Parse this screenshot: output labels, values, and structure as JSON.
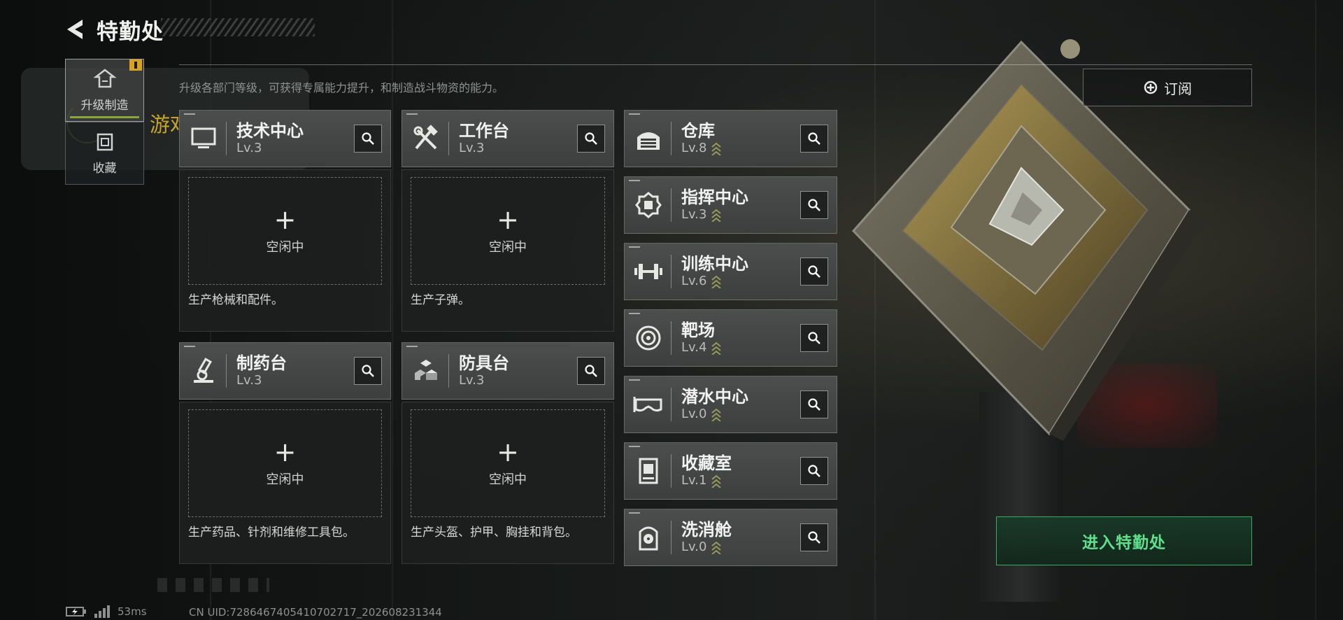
{
  "header": {
    "title": "特勤处"
  },
  "subtitle": "升级各部门等级，可获得专属能力提升，和制造战斗物资的能力。",
  "sidenav": {
    "items": [
      {
        "label": "升级制造",
        "icon": "upgrade-icon",
        "active": true,
        "badge": true
      },
      {
        "label": "收藏",
        "icon": "collection-icon",
        "active": false,
        "badge": false
      }
    ]
  },
  "toast": {
    "text": "游戏助手启动"
  },
  "subscribe": {
    "label": "订阅",
    "icon": "subscribe-icon"
  },
  "enter_button": {
    "label": "进入特勤处"
  },
  "workstations": [
    {
      "name": "技术中心",
      "level": "Lv.3",
      "icon": "tech-center-icon",
      "slot_plus": "+",
      "slot_status": "空闲中",
      "description": "生产枪械和配件。"
    },
    {
      "name": "工作台",
      "level": "Lv.3",
      "icon": "workbench-icon",
      "slot_plus": "+",
      "slot_status": "空闲中",
      "description": "生产子弹。"
    },
    {
      "name": "制药台",
      "level": "Lv.3",
      "icon": "pharmacy-icon",
      "slot_plus": "+",
      "slot_status": "空闲中",
      "description": "生产药品、针剂和维修工具包。"
    },
    {
      "name": "防具台",
      "level": "Lv.3",
      "icon": "armor-bench-icon",
      "slot_plus": "+",
      "slot_status": "空闲中",
      "description": "生产头盔、护甲、胸挂和背包。"
    }
  ],
  "facilities": [
    {
      "name": "仓库",
      "level": "Lv.8",
      "icon": "warehouse-icon"
    },
    {
      "name": "指挥中心",
      "level": "Lv.3",
      "icon": "command-center-icon"
    },
    {
      "name": "训练中心",
      "level": "Lv.6",
      "icon": "training-center-icon"
    },
    {
      "name": "靶场",
      "level": "Lv.4",
      "icon": "shooting-range-icon"
    },
    {
      "name": "潜水中心",
      "level": "Lv.0",
      "icon": "diving-center-icon"
    },
    {
      "name": "收藏室",
      "level": "Lv.1",
      "icon": "collection-room-icon"
    },
    {
      "name": "洗消舱",
      "level": "Lv.0",
      "icon": "decon-chamber-icon"
    }
  ],
  "status": {
    "ping": "53ms",
    "uid": "CN UID:7286467405410702717_202608231344"
  },
  "colors": {
    "accent_green": "#5fe08c",
    "badge_yellow": "#d7a21e",
    "toast_gold": "#c8a42a",
    "upgrade_chevron": "#9a9a5a"
  }
}
